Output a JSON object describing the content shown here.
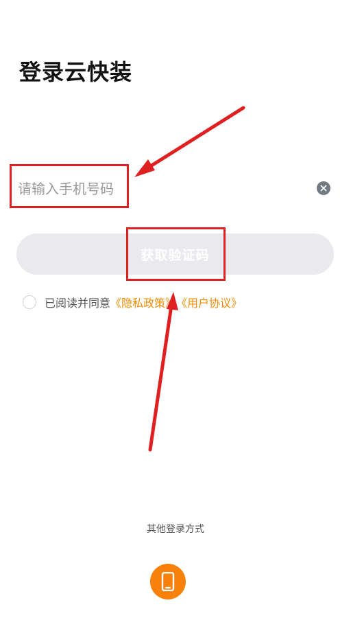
{
  "app": {
    "title": "登录云快装"
  },
  "login_form": {
    "phone_placeholder": "请输入手机号码",
    "phone_value": "",
    "clear_icon": "close-icon",
    "get_code_label": "获取验证码"
  },
  "agreement": {
    "prefix": "已阅读并同意",
    "privacy_link": "《隐私政策》",
    "terms_link": "《用户协议》",
    "checked": false
  },
  "other_login": {
    "label": "其他登录方式",
    "phone_icon": "phone-icon"
  },
  "colors": {
    "accent": "#f7810b",
    "link": "#f08c00",
    "button_disabled": "#e9e9ee",
    "annotation": "#e02020"
  }
}
